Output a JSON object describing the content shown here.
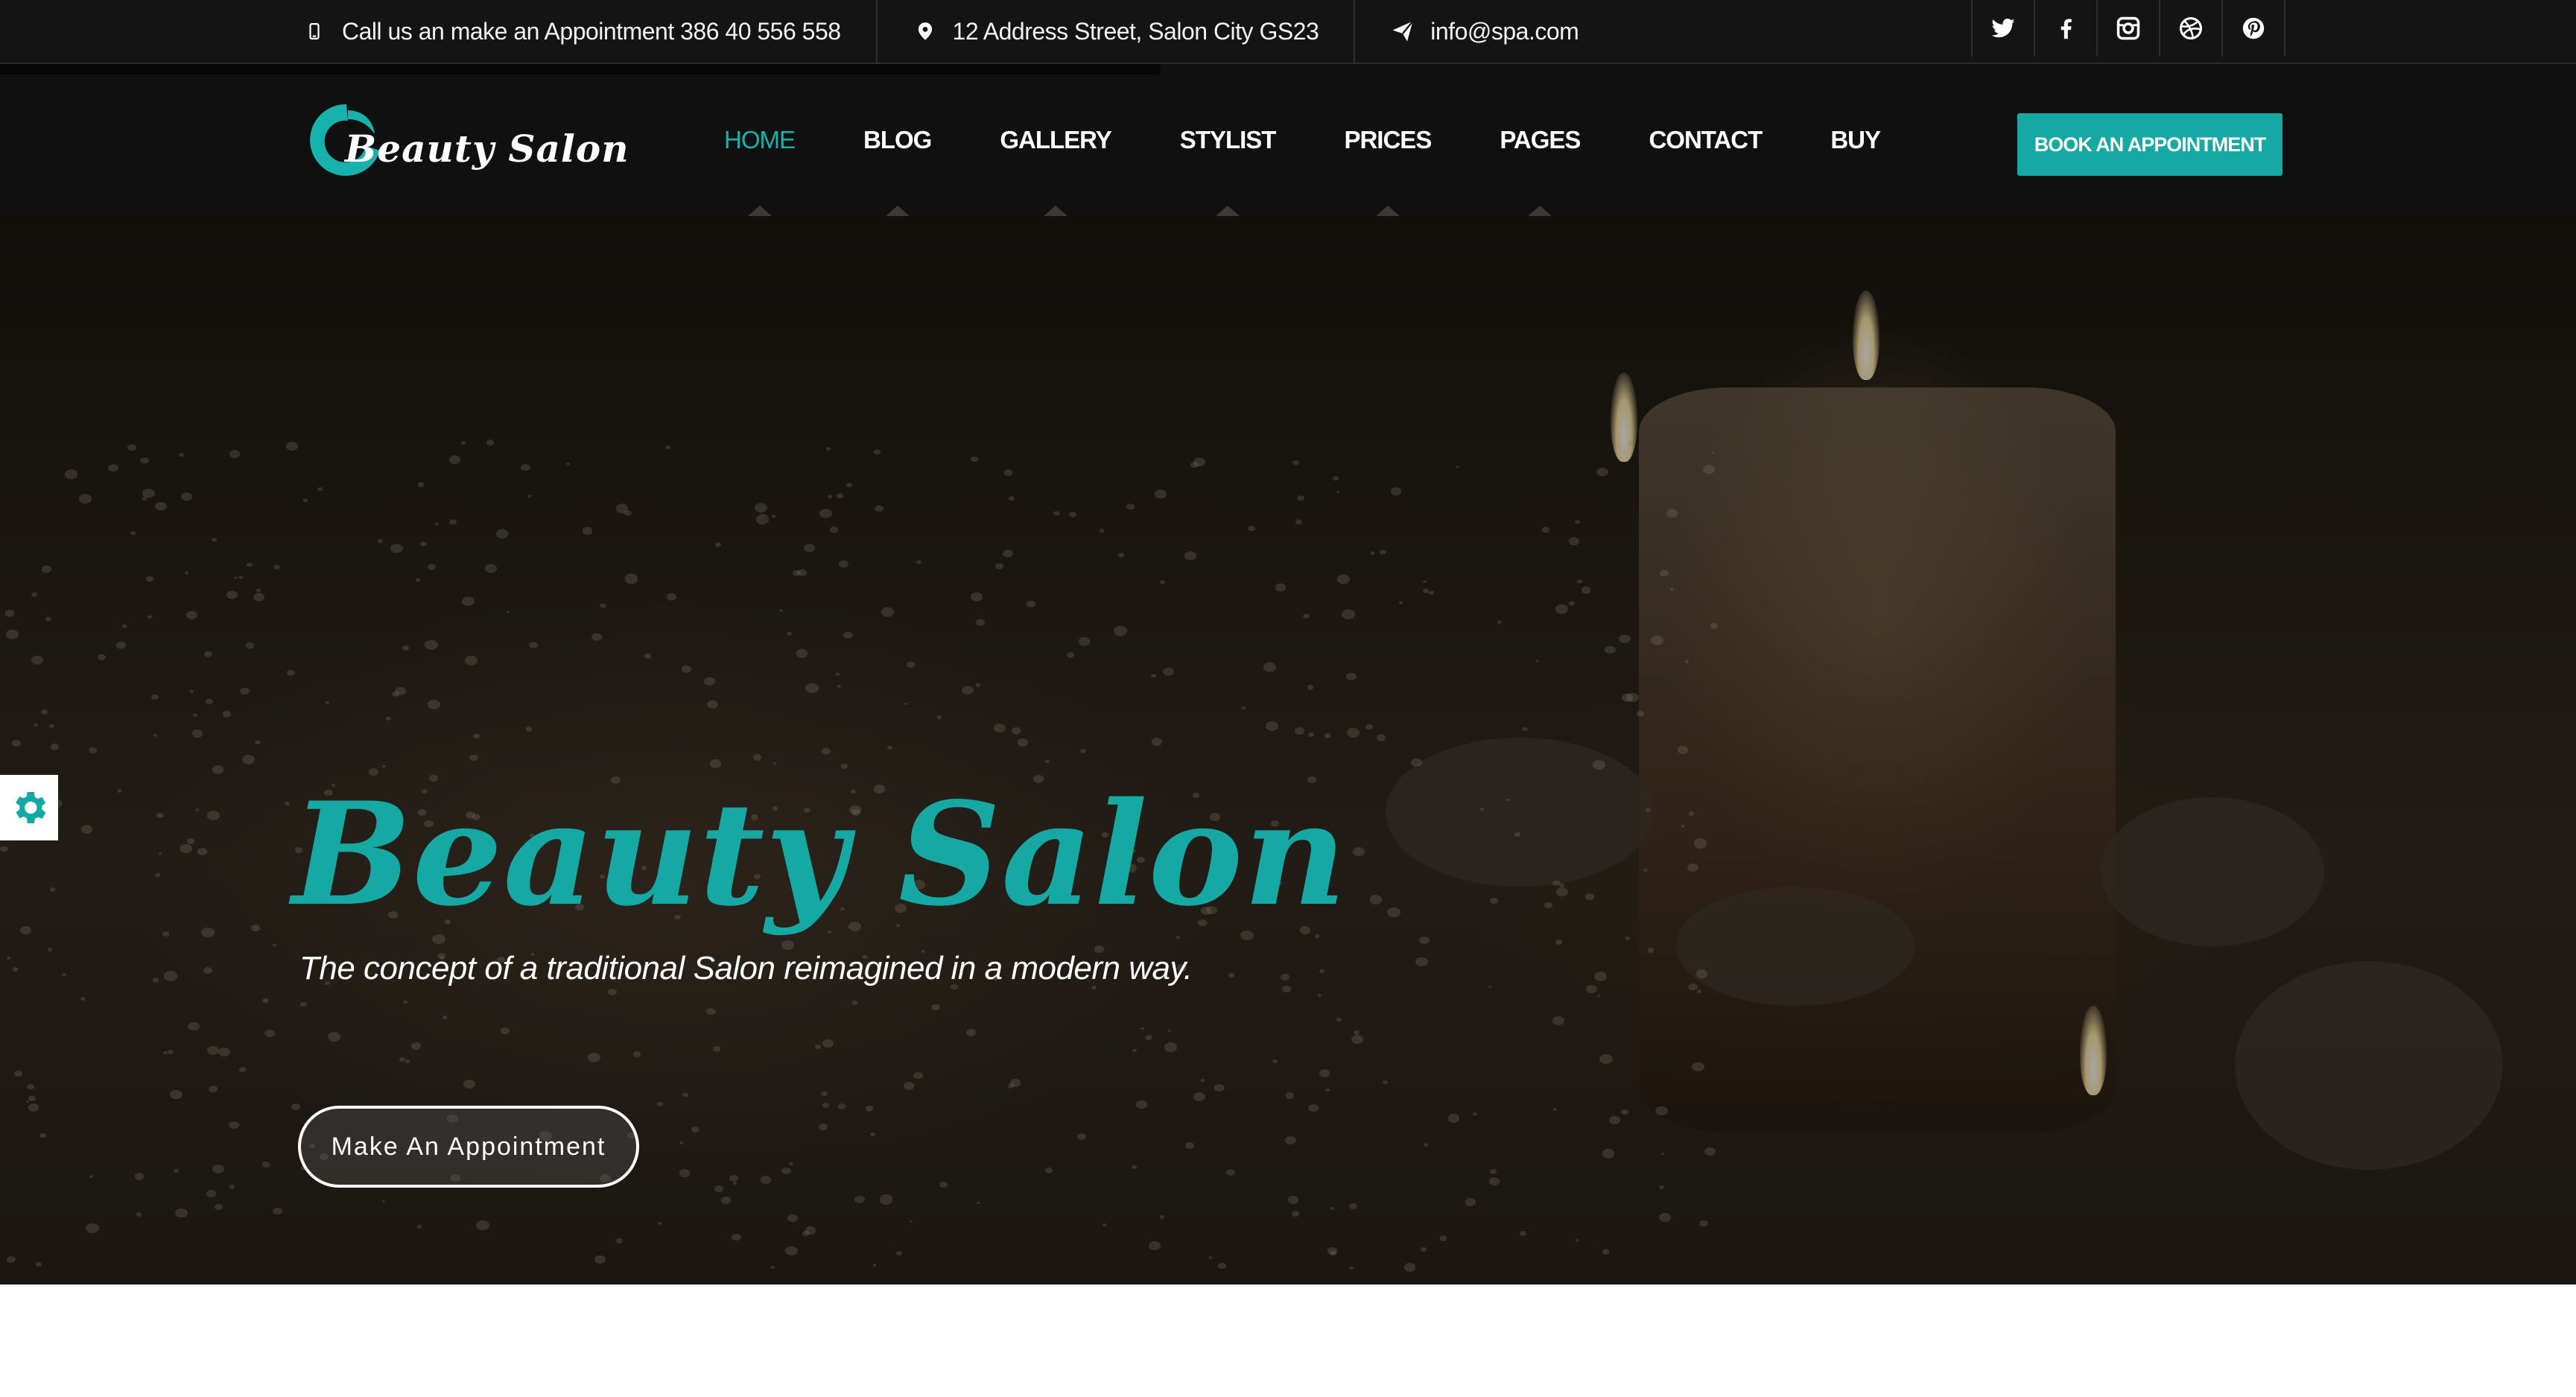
{
  "topbar": {
    "phone_text": "Call us an make an Appointment 386 40 556 558",
    "address_text": "12 Address Street, Salon City GS23",
    "email_text": "info@spa.com",
    "icons": [
      "mobile-phone-icon",
      "map-marker-icon",
      "paper-plane-icon"
    ],
    "socials": [
      "twitter-icon",
      "facebook-icon",
      "instagram-icon",
      "dribbble-icon",
      "pinterest-icon"
    ]
  },
  "logo": {
    "text": "Beauty Salon"
  },
  "nav": {
    "items": [
      {
        "label": "HOME",
        "active": true,
        "has_dropdown": true
      },
      {
        "label": "BLOG",
        "has_dropdown": true
      },
      {
        "label": "GALLERY",
        "has_dropdown": true
      },
      {
        "label": "STYLIST",
        "has_dropdown": true
      },
      {
        "label": "PRICES",
        "has_dropdown": true
      },
      {
        "label": "PAGES",
        "has_dropdown": true
      },
      {
        "label": "CONTACT",
        "has_dropdown": false
      },
      {
        "label": "BUY",
        "has_dropdown": false
      }
    ],
    "cta_label": "BOOK AN APPOINTMENT"
  },
  "hero": {
    "title": "Beauty Salon",
    "subtitle": "The concept of a traditional Salon reimagined in a modern way.",
    "button_label": "Make An Appointment"
  },
  "settings_panel": {
    "icon": "gear-icon"
  },
  "colors": {
    "accent": "#16a8a3",
    "topbar_bg": "#141414",
    "nav_bg": "#060606"
  }
}
